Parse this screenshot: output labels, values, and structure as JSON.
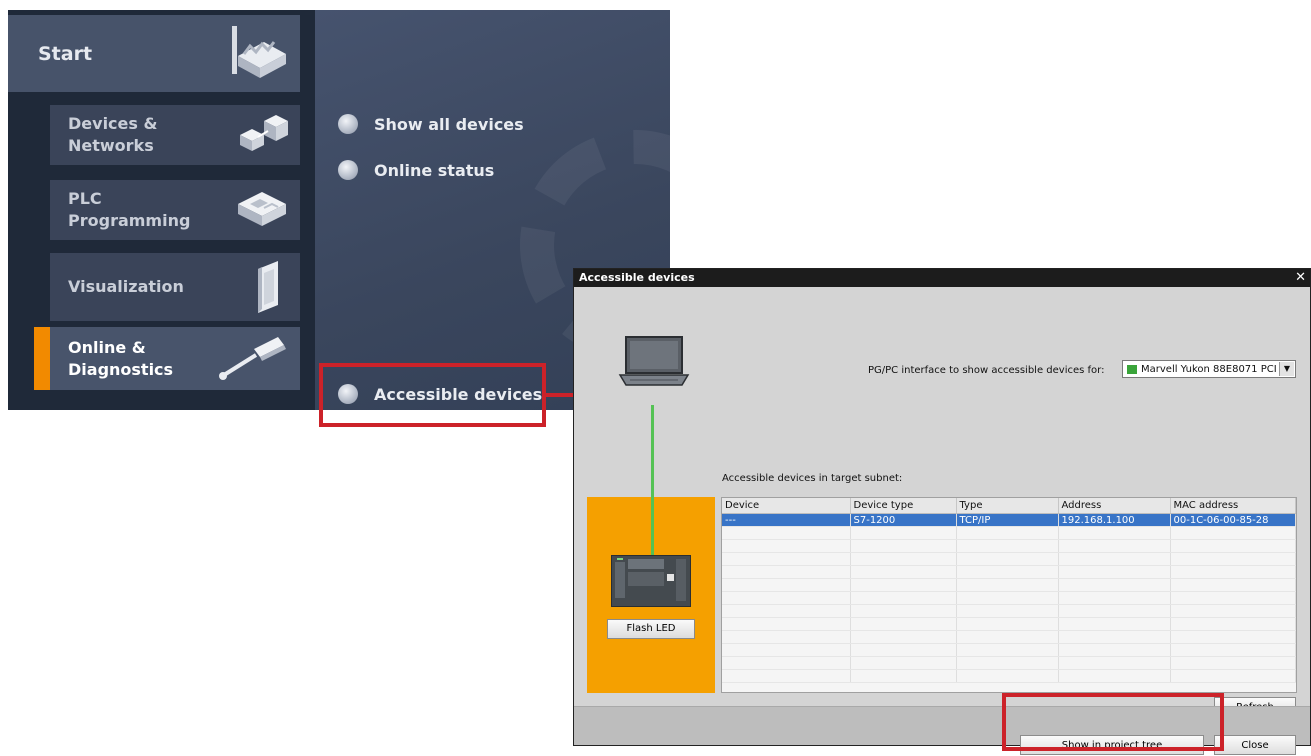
{
  "portal": {
    "start": "Start",
    "tiles": [
      {
        "label": "Devices &\nNetworks"
      },
      {
        "label": "PLC\nProgramming"
      },
      {
        "label": "Visualization"
      },
      {
        "label": "Online &\nDiagnostics"
      }
    ],
    "items": {
      "show_all": "Show all devices",
      "online_status": "Online status",
      "accessible": "Accessible devices"
    },
    "colors": {
      "accent": "#f28a00",
      "highlight": "#cc2229"
    }
  },
  "dialog": {
    "title": "Accessible devices",
    "close_glyph": "✕",
    "pgpc_label": "PG/PC interface to show accessible devices for:",
    "pgpc_value": "Marvell Yukon 88E8071 PCI",
    "subnet_label": "Accessible devices in target subnet:",
    "flash_led": "Flash LED",
    "columns": [
      "Device",
      "Device type",
      "Type",
      "Address",
      "MAC address"
    ],
    "row": {
      "device": "---",
      "device_type": "S7-1200",
      "type": "TCP/IP",
      "address": "192.168.1.100",
      "mac": "00-1C-06-00-85-28"
    },
    "refresh_prefix": "R",
    "refresh_rest": "efresh",
    "show_tree_prefix": "S",
    "show_tree_rest": "how in project tree",
    "close": "Close",
    "colors": {
      "orange_panel": "#f5a000",
      "link": "#54c254",
      "selected_row": "#3874c7"
    }
  }
}
